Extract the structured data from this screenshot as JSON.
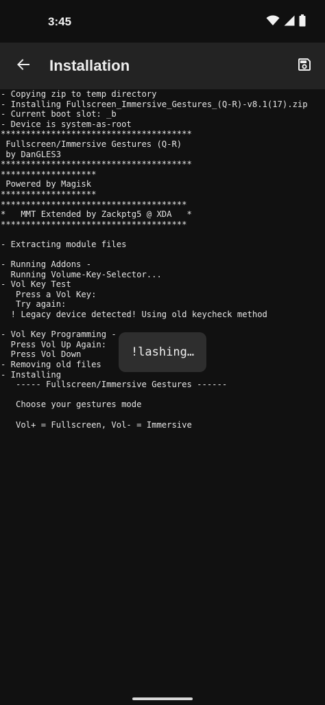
{
  "status_bar": {
    "time": "3:45",
    "icons": [
      "wifi-icon",
      "signal-icon",
      "battery-icon"
    ]
  },
  "app_bar": {
    "title": "Installation",
    "back_icon": "arrow-back-icon",
    "save_icon": "save-icon"
  },
  "console": {
    "lines": [
      "- Copying zip to temp directory",
      "- Installing Fullscreen_Immersive_Gestures_(Q-R)-v8.1(17).zip",
      "- Current boot slot: _b",
      "- Device is system-as-root",
      "**************************************",
      " Fullscreen/Immersive Gestures (Q-R)",
      " by DanGLES3",
      "**************************************",
      "*******************",
      " Powered by Magisk",
      "*******************",
      "*************************************",
      "*   MMT Extended by Zackptg5 @ XDA   *",
      "*************************************",
      "",
      "- Extracting module files",
      "",
      "- Running Addons -",
      "  Running Volume-Key-Selector...",
      "- Vol Key Test",
      "   Press a Vol Key:",
      "   Try again:",
      "  ! Legacy device detected! Using old keycheck method",
      "",
      "- Vol Key Programming -",
      "  Press Vol Up Again:",
      "  Press Vol Down",
      "- Removing old files",
      "- Installing",
      "   ----- Fullscreen/Immersive Gestures ------",
      "",
      "   Choose your gestures mode",
      "",
      "   Vol+ = Fullscreen, Vol- = Immersive"
    ]
  },
  "toast": {
    "text": "!lashing…"
  }
}
